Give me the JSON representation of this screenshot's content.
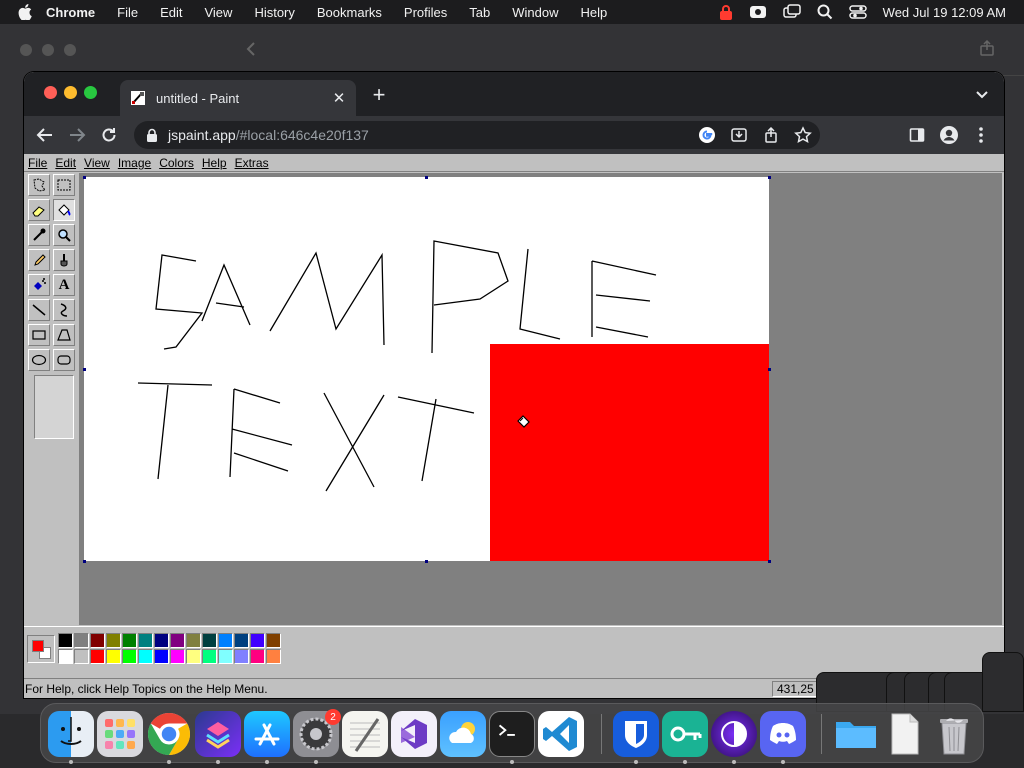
{
  "menubar": {
    "app_name": "Chrome",
    "items": [
      "File",
      "Edit",
      "View",
      "History",
      "Bookmarks",
      "Profiles",
      "Tab",
      "Window",
      "Help"
    ],
    "clock": "Wed Jul 19  12:09 AM"
  },
  "browser": {
    "tab_title": "untitled - Paint",
    "url_host": "jspaint.app",
    "url_path": "/#local:646c4e20f137"
  },
  "paint": {
    "menu": [
      "File",
      "Edit",
      "View",
      "Image",
      "Colors",
      "Help",
      "Extras"
    ],
    "status_help": "For Help, click Help Topics on the Help Menu.",
    "coords": "431,25",
    "foreground_color": "#ff0000",
    "background_color": "#ffffff",
    "palette": [
      "#000000",
      "#808080",
      "#800000",
      "#808000",
      "#008000",
      "#008080",
      "#000080",
      "#800080",
      "#808040",
      "#004040",
      "#0080ff",
      "#004080",
      "#4000ff",
      "#804000",
      "#ffffff",
      "#c0c0c0",
      "#ff0000",
      "#ffff00",
      "#00ff00",
      "#00ffff",
      "#0000ff",
      "#ff00ff",
      "#ffff80",
      "#00ff80",
      "#80ffff",
      "#8080ff",
      "#ff0080",
      "#ff8040"
    ],
    "tools": [
      "free-form-select-icon",
      "select-icon",
      "eraser-icon",
      "fill-icon",
      "pick-color-icon",
      "magnifier-icon",
      "pencil-icon",
      "brush-icon",
      "airbrush-icon",
      "text-icon",
      "line-icon",
      "curve-icon",
      "rectangle-icon",
      "polygon-icon",
      "ellipse-icon",
      "rounded-rectangle-icon"
    ],
    "active_tool": "fill-icon",
    "text_tool_glyph": "A"
  },
  "dock": {
    "settings_badge": "2",
    "apps": [
      "finder",
      "launchpad",
      "chrome",
      "shortcuts",
      "app-store",
      "system-settings",
      "textedit",
      "visual-studio",
      "weather",
      "terminal",
      "vscode",
      "bitwarden",
      "vpn",
      "tor-browser",
      "discord",
      "folder",
      "document",
      "trash"
    ]
  }
}
